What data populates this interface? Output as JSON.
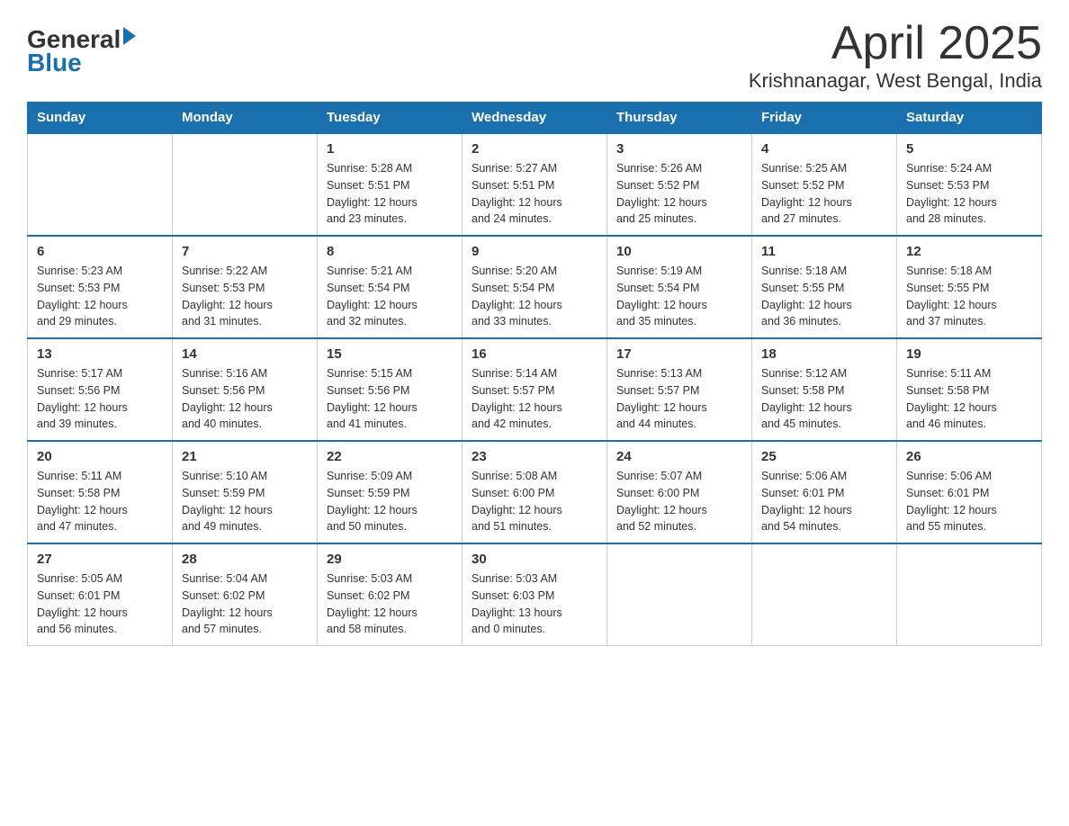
{
  "header": {
    "logo_general": "General",
    "logo_blue": "Blue",
    "title": "April 2025",
    "location": "Krishnanagar, West Bengal, India"
  },
  "days_of_week": [
    "Sunday",
    "Monday",
    "Tuesday",
    "Wednesday",
    "Thursday",
    "Friday",
    "Saturday"
  ],
  "weeks": [
    {
      "days": [
        {
          "number": "",
          "info": ""
        },
        {
          "number": "",
          "info": ""
        },
        {
          "number": "1",
          "info": "Sunrise: 5:28 AM\nSunset: 5:51 PM\nDaylight: 12 hours\nand 23 minutes."
        },
        {
          "number": "2",
          "info": "Sunrise: 5:27 AM\nSunset: 5:51 PM\nDaylight: 12 hours\nand 24 minutes."
        },
        {
          "number": "3",
          "info": "Sunrise: 5:26 AM\nSunset: 5:52 PM\nDaylight: 12 hours\nand 25 minutes."
        },
        {
          "number": "4",
          "info": "Sunrise: 5:25 AM\nSunset: 5:52 PM\nDaylight: 12 hours\nand 27 minutes."
        },
        {
          "number": "5",
          "info": "Sunrise: 5:24 AM\nSunset: 5:53 PM\nDaylight: 12 hours\nand 28 minutes."
        }
      ]
    },
    {
      "days": [
        {
          "number": "6",
          "info": "Sunrise: 5:23 AM\nSunset: 5:53 PM\nDaylight: 12 hours\nand 29 minutes."
        },
        {
          "number": "7",
          "info": "Sunrise: 5:22 AM\nSunset: 5:53 PM\nDaylight: 12 hours\nand 31 minutes."
        },
        {
          "number": "8",
          "info": "Sunrise: 5:21 AM\nSunset: 5:54 PM\nDaylight: 12 hours\nand 32 minutes."
        },
        {
          "number": "9",
          "info": "Sunrise: 5:20 AM\nSunset: 5:54 PM\nDaylight: 12 hours\nand 33 minutes."
        },
        {
          "number": "10",
          "info": "Sunrise: 5:19 AM\nSunset: 5:54 PM\nDaylight: 12 hours\nand 35 minutes."
        },
        {
          "number": "11",
          "info": "Sunrise: 5:18 AM\nSunset: 5:55 PM\nDaylight: 12 hours\nand 36 minutes."
        },
        {
          "number": "12",
          "info": "Sunrise: 5:18 AM\nSunset: 5:55 PM\nDaylight: 12 hours\nand 37 minutes."
        }
      ]
    },
    {
      "days": [
        {
          "number": "13",
          "info": "Sunrise: 5:17 AM\nSunset: 5:56 PM\nDaylight: 12 hours\nand 39 minutes."
        },
        {
          "number": "14",
          "info": "Sunrise: 5:16 AM\nSunset: 5:56 PM\nDaylight: 12 hours\nand 40 minutes."
        },
        {
          "number": "15",
          "info": "Sunrise: 5:15 AM\nSunset: 5:56 PM\nDaylight: 12 hours\nand 41 minutes."
        },
        {
          "number": "16",
          "info": "Sunrise: 5:14 AM\nSunset: 5:57 PM\nDaylight: 12 hours\nand 42 minutes."
        },
        {
          "number": "17",
          "info": "Sunrise: 5:13 AM\nSunset: 5:57 PM\nDaylight: 12 hours\nand 44 minutes."
        },
        {
          "number": "18",
          "info": "Sunrise: 5:12 AM\nSunset: 5:58 PM\nDaylight: 12 hours\nand 45 minutes."
        },
        {
          "number": "19",
          "info": "Sunrise: 5:11 AM\nSunset: 5:58 PM\nDaylight: 12 hours\nand 46 minutes."
        }
      ]
    },
    {
      "days": [
        {
          "number": "20",
          "info": "Sunrise: 5:11 AM\nSunset: 5:58 PM\nDaylight: 12 hours\nand 47 minutes."
        },
        {
          "number": "21",
          "info": "Sunrise: 5:10 AM\nSunset: 5:59 PM\nDaylight: 12 hours\nand 49 minutes."
        },
        {
          "number": "22",
          "info": "Sunrise: 5:09 AM\nSunset: 5:59 PM\nDaylight: 12 hours\nand 50 minutes."
        },
        {
          "number": "23",
          "info": "Sunrise: 5:08 AM\nSunset: 6:00 PM\nDaylight: 12 hours\nand 51 minutes."
        },
        {
          "number": "24",
          "info": "Sunrise: 5:07 AM\nSunset: 6:00 PM\nDaylight: 12 hours\nand 52 minutes."
        },
        {
          "number": "25",
          "info": "Sunrise: 5:06 AM\nSunset: 6:01 PM\nDaylight: 12 hours\nand 54 minutes."
        },
        {
          "number": "26",
          "info": "Sunrise: 5:06 AM\nSunset: 6:01 PM\nDaylight: 12 hours\nand 55 minutes."
        }
      ]
    },
    {
      "days": [
        {
          "number": "27",
          "info": "Sunrise: 5:05 AM\nSunset: 6:01 PM\nDaylight: 12 hours\nand 56 minutes."
        },
        {
          "number": "28",
          "info": "Sunrise: 5:04 AM\nSunset: 6:02 PM\nDaylight: 12 hours\nand 57 minutes."
        },
        {
          "number": "29",
          "info": "Sunrise: 5:03 AM\nSunset: 6:02 PM\nDaylight: 12 hours\nand 58 minutes."
        },
        {
          "number": "30",
          "info": "Sunrise: 5:03 AM\nSunset: 6:03 PM\nDaylight: 13 hours\nand 0 minutes."
        },
        {
          "number": "",
          "info": ""
        },
        {
          "number": "",
          "info": ""
        },
        {
          "number": "",
          "info": ""
        }
      ]
    }
  ]
}
